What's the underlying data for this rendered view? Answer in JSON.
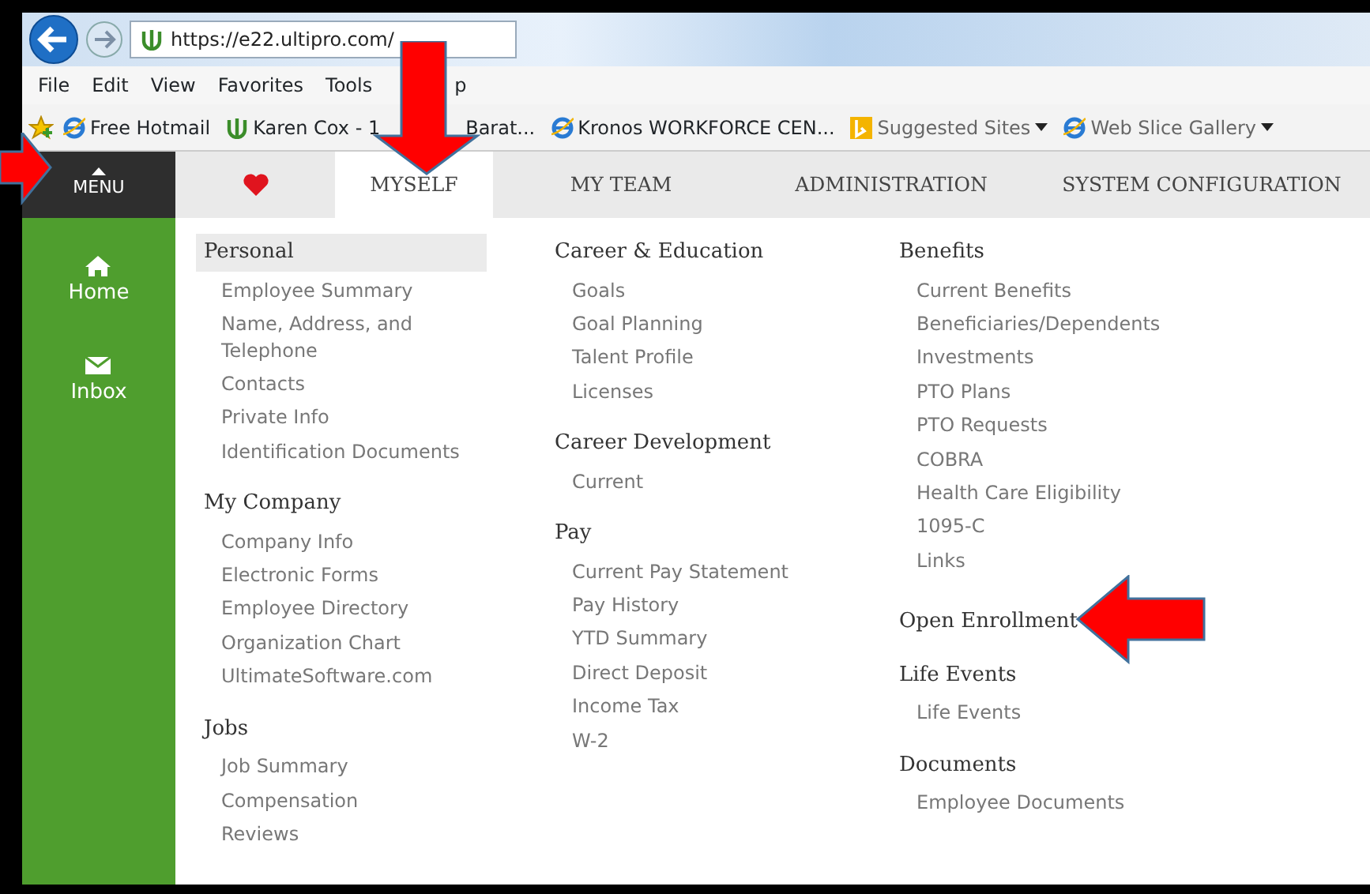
{
  "browser": {
    "url": "https://e22.ultipro.com/",
    "menu": [
      "File",
      "Edit",
      "View",
      "Favorites",
      "Tools",
      "p"
    ],
    "bookmarks": [
      {
        "label": "Free Hotmail",
        "kind": "ie"
      },
      {
        "label": "Karen Cox - 1",
        "kind": "ultipro"
      },
      {
        "label": "Barat...",
        "kind": "none"
      },
      {
        "label": "Kronos WORKFORCE CEN...",
        "kind": "ie"
      },
      {
        "label": "Suggested Sites",
        "kind": "bing",
        "dropdown": true
      },
      {
        "label": "Web Slice Gallery",
        "kind": "ie",
        "dropdown": true
      }
    ]
  },
  "sidebar": {
    "menu_label": "MENU",
    "items": [
      {
        "label": "Home"
      },
      {
        "label": "Inbox"
      }
    ]
  },
  "tabs": [
    {
      "kind": "favorites",
      "selected": false
    },
    {
      "kind": "text",
      "label": "MYSELF",
      "selected": true
    },
    {
      "kind": "text",
      "label": "MY TEAM",
      "selected": false
    },
    {
      "kind": "text",
      "label": "ADMINISTRATION",
      "selected": false
    },
    {
      "kind": "text",
      "label": "SYSTEM CONFIGURATION",
      "selected": false
    }
  ],
  "columns": [
    [
      {
        "title": "Personal",
        "selected": true,
        "items": [
          "Employee Summary",
          "Name, Address, and Telephone",
          "Contacts",
          "Private Info",
          "Identification Documents"
        ]
      },
      {
        "title": "My Company",
        "selected": false,
        "items": [
          "Company Info",
          "Electronic Forms",
          "Employee Directory",
          "Organization Chart",
          "UltimateSoftware.com"
        ]
      },
      {
        "title": "Jobs",
        "selected": false,
        "items": [
          "Job Summary",
          "Compensation",
          "Reviews"
        ]
      }
    ],
    [
      {
        "title": "Career & Education",
        "selected": false,
        "items": [
          "Goals",
          "Goal Planning",
          "Talent Profile",
          "Licenses"
        ]
      },
      {
        "title": "Career Development",
        "selected": false,
        "items": [
          "Current"
        ]
      },
      {
        "title": "Pay",
        "selected": false,
        "items": [
          "Current Pay Statement",
          "Pay History",
          "YTD Summary",
          "Direct Deposit",
          "Income Tax",
          "W-2"
        ]
      }
    ],
    [
      {
        "title": "Benefits",
        "selected": false,
        "items": [
          "Current Benefits",
          "Beneficiaries/Dependents",
          "Investments",
          "PTO Plans",
          "PTO Requests",
          "COBRA",
          "Health Care Eligibility",
          "1095-C",
          "Links"
        ]
      },
      {
        "title": "Open Enrollment",
        "selected": false
      },
      {
        "title": "Life Events",
        "selected": false,
        "items": [
          "Life Events"
        ]
      },
      {
        "title": "Documents",
        "selected": false,
        "items": [
          "Employee Documents"
        ]
      }
    ]
  ],
  "annotations": [
    {
      "kind": "arrow"
    },
    {
      "kind": "arrow"
    },
    {
      "kind": "arrow"
    }
  ]
}
